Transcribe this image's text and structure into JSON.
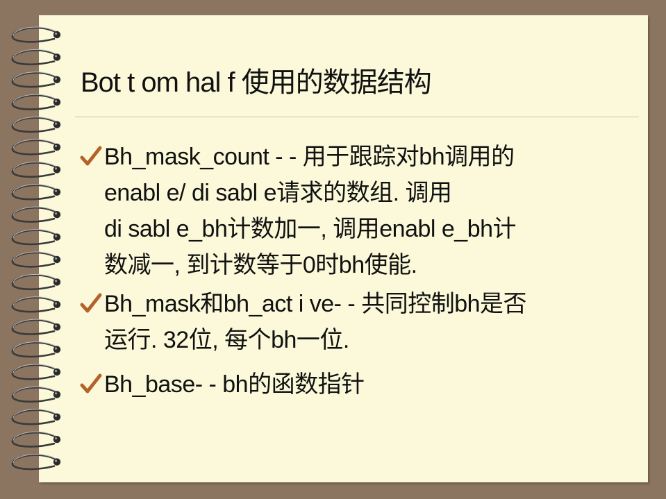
{
  "slide": {
    "title": "Bot t om hal f 使用的数据结构",
    "bullets": [
      {
        "lines": [
          "Bh_mask_count - - 用于跟踪对bh调用的",
          "enabl e/ di sabl e请求的数组.   调用",
          "di sabl e_bh计数加一, 调用enabl e_bh计",
          "数减一, 到计数等于0时bh使能."
        ]
      },
      {
        "lines": [
          "Bh_mask和bh_act i ve- - 共同控制bh是否",
          "运行. 32位, 每个bh一位."
        ]
      },
      {
        "lines": [
          "Bh_base- - bh的函数指针"
        ]
      }
    ]
  },
  "colors": {
    "background": "#8c7560",
    "paper": "#fbf9d9",
    "checkmark": "#b4622a",
    "text": "#111111"
  },
  "icons": {
    "bullet": "checkmark-icon",
    "binding": "spiral-binding-icon"
  }
}
